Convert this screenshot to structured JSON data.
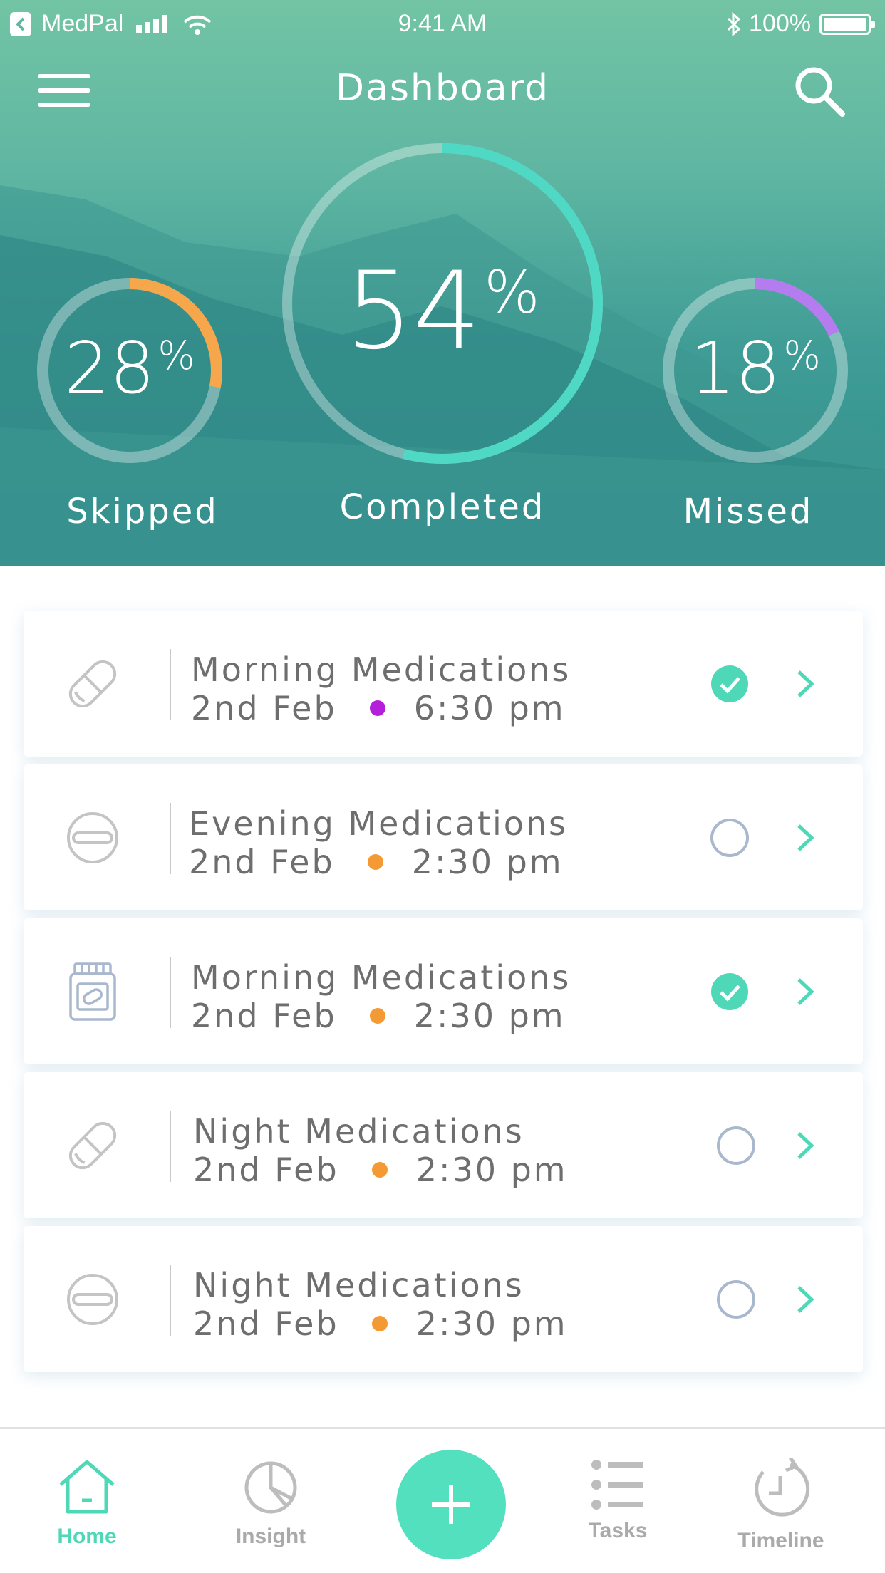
{
  "status_bar": {
    "app_back": "MedPal",
    "time": "9:41 AM",
    "battery": "100%"
  },
  "nav": {
    "title": "Dashboard",
    "menu_icon": "hamburger-menu-icon",
    "search_icon": "search-icon"
  },
  "stats": {
    "skipped": {
      "value": "28",
      "unit": "%",
      "label": "Skipped",
      "fraction": 0.28,
      "color": "#f6a64b"
    },
    "completed": {
      "value": "54",
      "unit": "%",
      "label": "Completed",
      "fraction": 0.54,
      "color": "#4fd8c4"
    },
    "missed": {
      "value": "18",
      "unit": "%",
      "label": "Missed",
      "fraction": 0.18,
      "color": "#b57cf0"
    }
  },
  "medications": [
    {
      "title": "Morning Medications",
      "date": "2nd Feb",
      "time": "6:30 pm",
      "dot_color": "#b51fdc",
      "icon": "pill-capsule-icon",
      "done": true
    },
    {
      "title": "Evening Medications",
      "date": "2nd Feb",
      "time": "2:30 pm",
      "dot_color": "#f39a35",
      "icon": "tablet-icon",
      "done": false
    },
    {
      "title": "Morning Medications",
      "date": "2nd Feb",
      "time": "2:30 pm",
      "dot_color": "#f39a35",
      "icon": "pill-bottle-icon",
      "done": true
    },
    {
      "title": "Night Medications",
      "date": "2nd Feb",
      "time": "2:30 pm",
      "dot_color": "#f39a35",
      "icon": "pill-capsule-icon",
      "done": false
    },
    {
      "title": "Night Medications",
      "date": "2nd Feb",
      "time": "2:30 pm",
      "dot_color": "#f39a35",
      "icon": "tablet-icon",
      "done": false
    }
  ],
  "tabs": {
    "home": "Home",
    "insight": "Insight",
    "tasks": "Tasks",
    "timeline": "Timeline",
    "add_icon": "plus-icon"
  },
  "colors": {
    "accent": "#52e0bf",
    "check": "#4fd8b7",
    "pending_ring": "#a9b8cc"
  }
}
